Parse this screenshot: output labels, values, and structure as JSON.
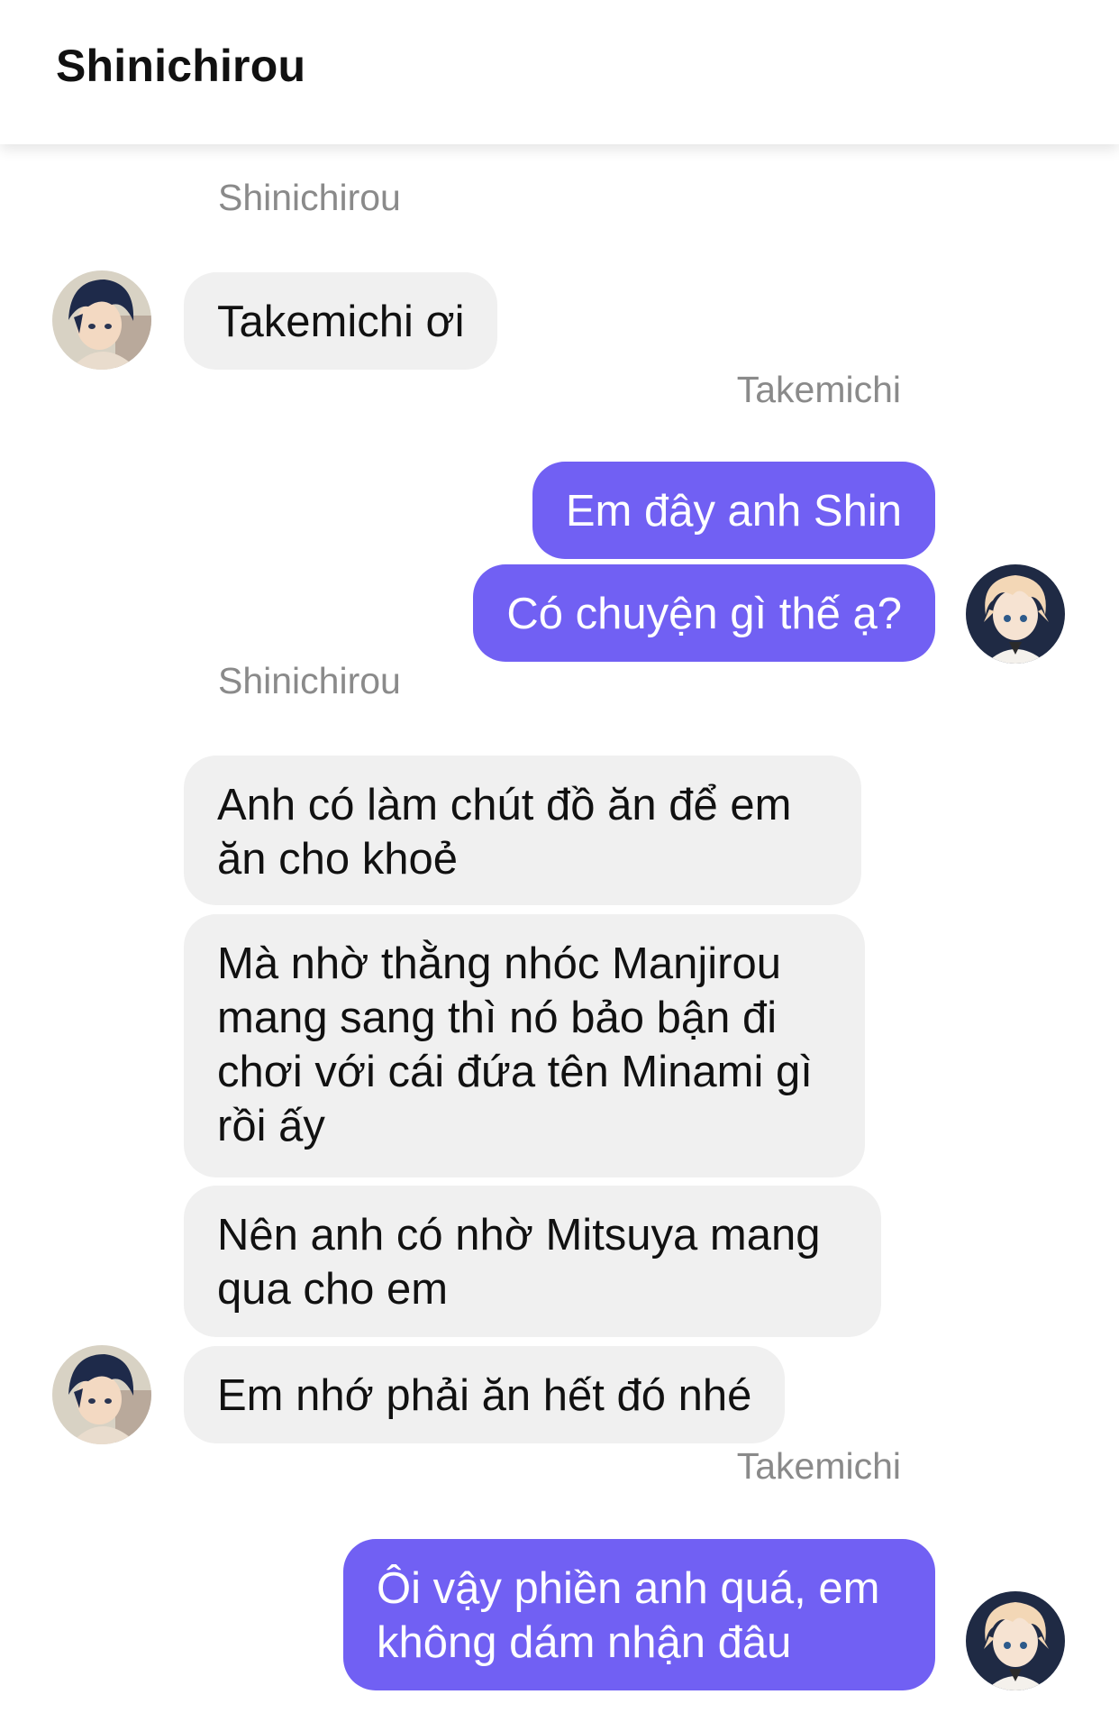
{
  "header": {
    "title": "Shinichirou"
  },
  "messages": [
    {
      "sender": "Shinichirou",
      "direction": "in",
      "text": "Takemichi ơi"
    },
    {
      "sender": "Takemichi",
      "direction": "out",
      "text": "Em đây anh Shin"
    },
    {
      "sender": "Takemichi",
      "direction": "out",
      "text": "Có chuyện gì thế ạ?"
    },
    {
      "sender": "Shinichirou",
      "direction": "in",
      "text": "Anh có làm chút đồ ăn để em ăn cho khoẻ"
    },
    {
      "sender": "Shinichirou",
      "direction": "in",
      "text": "Mà nhờ thằng nhóc Manjirou mang sang thì nó bảo bận đi chơi với cái đứa tên Minami gì rồi ấy"
    },
    {
      "sender": "Shinichirou",
      "direction": "in",
      "text": "Nên anh có nhờ Mitsuya mang qua cho em"
    },
    {
      "sender": "Shinichirou",
      "direction": "in",
      "text": "Em nhớ phải ăn hết đó nhé"
    },
    {
      "sender": "Takemichi",
      "direction": "out",
      "text": "Ôi vậy phiền anh quá, em không dám nhận đâu"
    }
  ],
  "avatars": {
    "shinichirou": "avatar-dark-hair-icon",
    "takemichi": "avatar-blond-hair-icon"
  },
  "colors": {
    "outgoing_bubble": "#7160f3",
    "incoming_bubble": "#f0f0f0",
    "sender_label": "#8a8a8a"
  }
}
